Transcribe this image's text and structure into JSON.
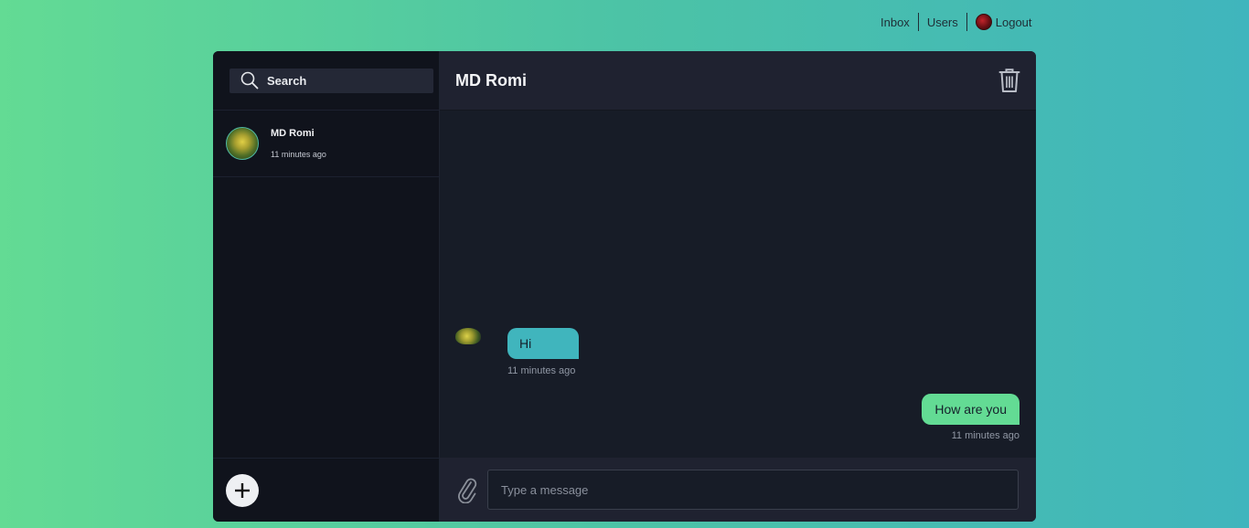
{
  "nav": {
    "inbox": "Inbox",
    "users": "Users",
    "logout": "Logout"
  },
  "sidebar": {
    "search": {
      "placeholder": "Search",
      "icon": "search-icon"
    },
    "conversations": [
      {
        "name": "MD Romi",
        "time": "11 minutes ago"
      }
    ],
    "add_icon": "plus-icon"
  },
  "chat": {
    "title": "MD Romi",
    "delete_icon": "trash-icon",
    "messages": [
      {
        "direction": "incoming",
        "text": "Hi",
        "time": "11 minutes ago"
      },
      {
        "direction": "outgoing",
        "text": "How are you",
        "time": "11 minutes ago"
      }
    ],
    "composer": {
      "placeholder": "Type a message",
      "attach_icon": "paperclip-icon"
    }
  },
  "colors": {
    "incoming_bubble": "#40b5bd",
    "outgoing_bubble": "#63db94",
    "panel_dark": "#10131c",
    "chat_bg": "#171c27"
  }
}
